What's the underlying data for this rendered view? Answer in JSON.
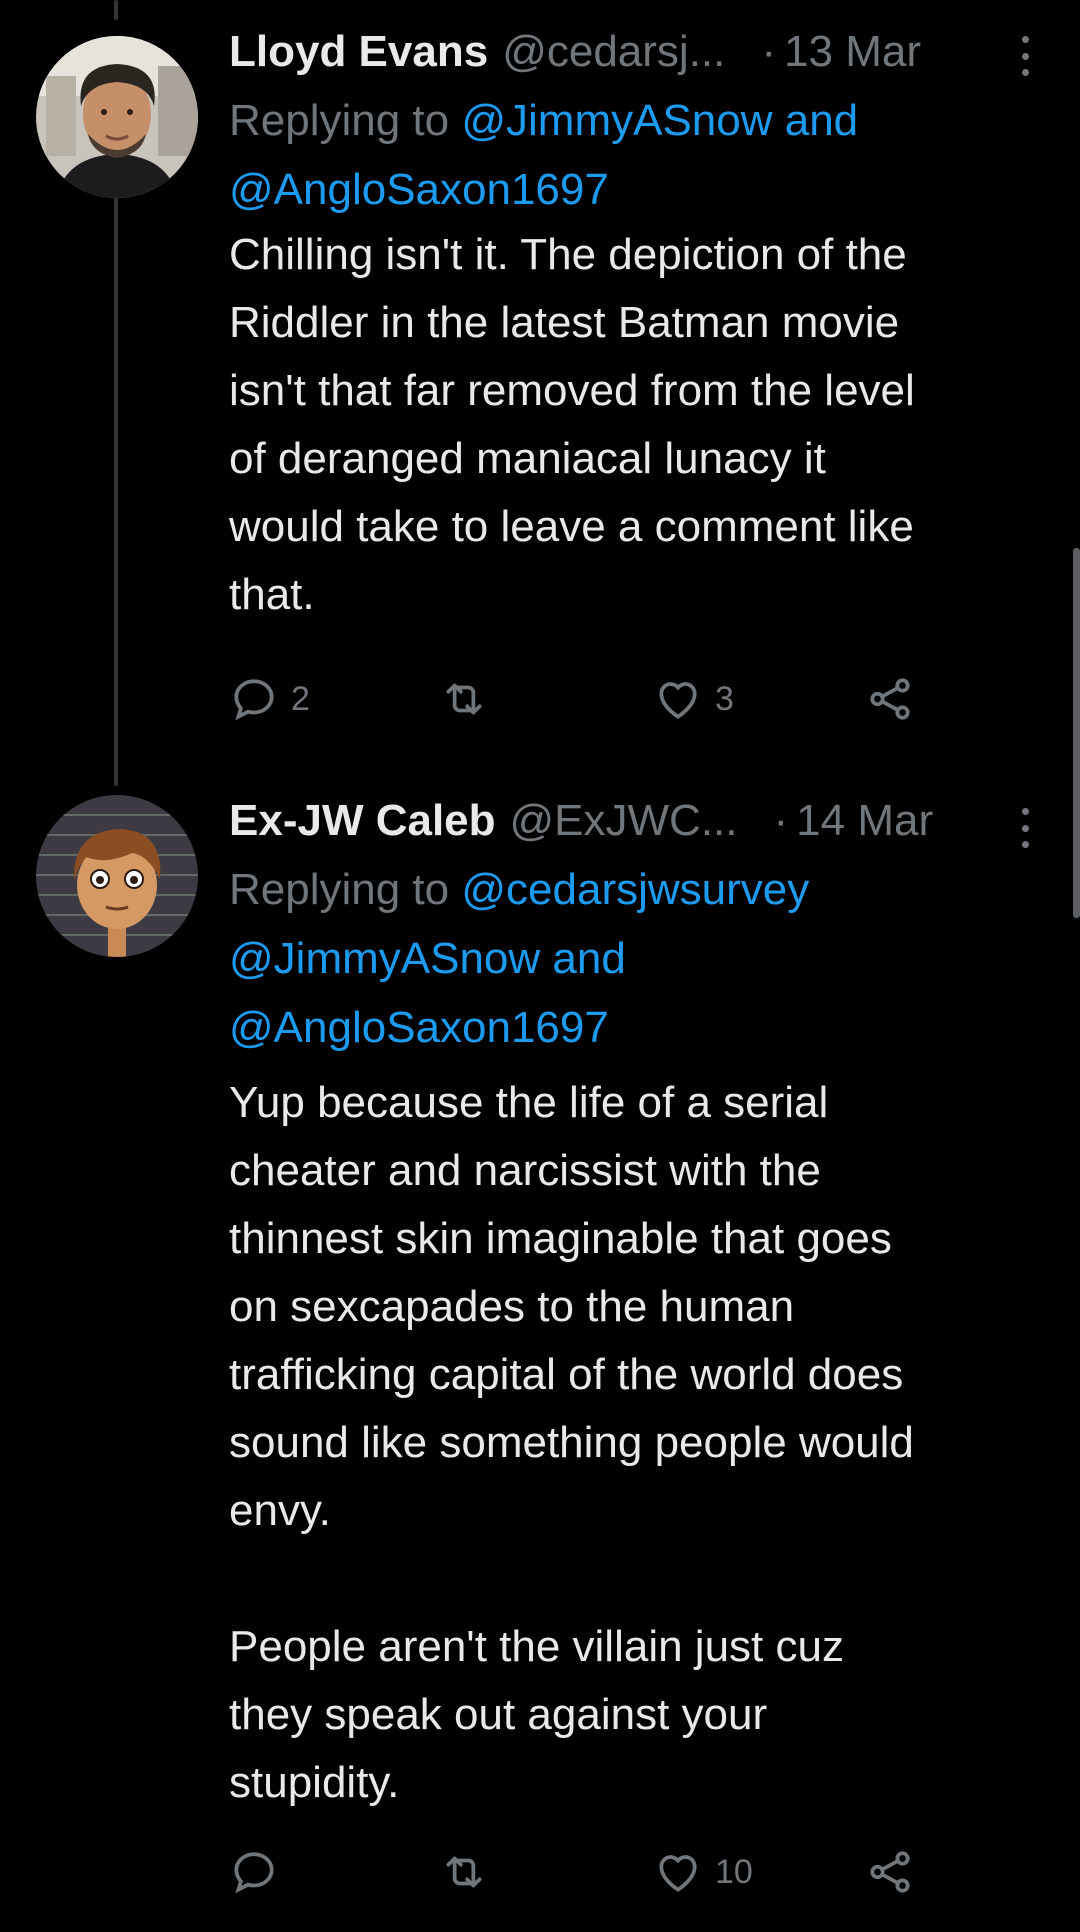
{
  "tweets": [
    {
      "name": "Lloyd Evans",
      "handle": "@cedarsj...",
      "separator": "·",
      "date": "13 Mar",
      "replying_prefix": "Replying to ",
      "replying_lines": [
        "@JimmyASnow and",
        "@AngloSaxon1697"
      ],
      "text": "Chilling isn't it. The depiction of the\nRiddler in the latest Batman movie\nisn't that far removed from the level\nof deranged maniacal lunacy it\nwould take to leave a comment like\nthat.",
      "replies": "2",
      "retweets": "",
      "likes": "3"
    },
    {
      "name": "Ex-JW Caleb",
      "handle": "@ExJWC...",
      "separator": "·",
      "date": "14 Mar",
      "replying_prefix": "Replying to ",
      "replying_lines": [
        "@cedarsjwsurvey",
        "@JimmyASnow and",
        "@AngloSaxon1697"
      ],
      "text": "Yup because the life of a serial\ncheater and narcissist with the\nthinnest skin imaginable that goes\non sexcapades to the human\ntrafficking capital of the world does\nsound like something people would\nenvy.\n\nPeople aren't the villain just cuz\nthey speak out against your\nstupidity.",
      "replies": "",
      "retweets": "",
      "likes": "10"
    }
  ],
  "icons": {
    "reply": "reply-icon",
    "retweet": "retweet-icon",
    "like": "heart-icon",
    "share": "share-icon",
    "more": "more-vertical-icon"
  },
  "colors": {
    "background": "#000000",
    "text": "#e7e9ea",
    "secondary": "#71767b",
    "link": "#1d9bf0"
  }
}
